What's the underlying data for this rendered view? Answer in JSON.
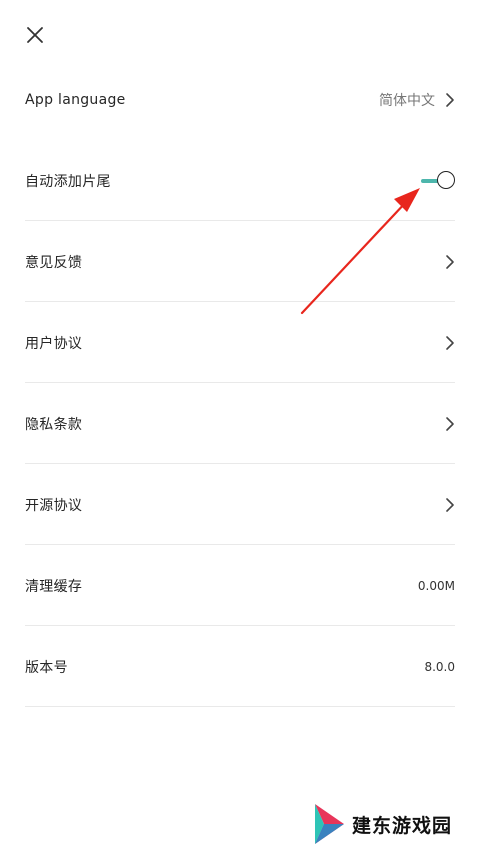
{
  "header": {
    "close_icon": "close-icon"
  },
  "settings": {
    "app_language": {
      "label": "App language",
      "value": "简体中文"
    },
    "auto_add_outro": {
      "label": "自动添加片尾",
      "toggle_on": true
    },
    "feedback": {
      "label": "意见反馈"
    },
    "user_agreement": {
      "label": "用户协议"
    },
    "privacy_policy": {
      "label": "隐私条款"
    },
    "open_source": {
      "label": "开源协议"
    },
    "clear_cache": {
      "label": "清理缓存",
      "value": "0.00M"
    },
    "version": {
      "label": "版本号",
      "value": "8.0.0"
    }
  },
  "colors": {
    "toggle_accent": "#4db6ac",
    "annotation_arrow": "#e8261d",
    "divider": "#e9e9e9"
  },
  "watermark": {
    "text": "建东游戏园"
  }
}
